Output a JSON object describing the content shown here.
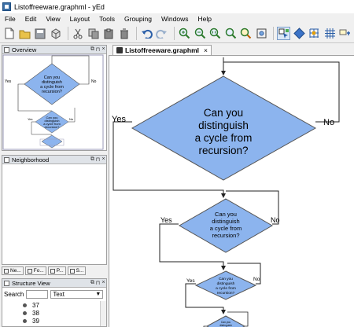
{
  "window": {
    "title": "Listoffreeware.graphml - yEd"
  },
  "menu": [
    "File",
    "Edit",
    "View",
    "Layout",
    "Tools",
    "Grouping",
    "Windows",
    "Help"
  ],
  "toolbar": {
    "icons": [
      "new-file-icon",
      "open-folder-icon",
      "save-icon",
      "3d-box-icon",
      "cut-icon",
      "copy-icon",
      "paste-icon",
      "delete-icon",
      "undo-icon",
      "redo-icon",
      "zoom-in-icon",
      "zoom-out-icon",
      "zoom-original-icon",
      "zoom-area-icon",
      "zoom-fit-icon",
      "fit-content-icon",
      "select-mode-icon",
      "navigate-icon",
      "grid-snap-icon",
      "grid-icon",
      "properties-icon"
    ]
  },
  "panels": {
    "overview": {
      "title": "Overview",
      "buttons": [
        "⧉",
        "⊓",
        "×"
      ]
    },
    "neighborhood": {
      "title": "Neighborhood",
      "buttons": [
        "⧉",
        "⊓",
        "×"
      ]
    },
    "bottom_tabs": [
      "Ne...",
      "Fo...",
      "P...",
      "S..."
    ],
    "structure": {
      "title": "Structure View",
      "buttons": [
        "⧉",
        "⊓",
        "×"
      ],
      "search_label": "Search",
      "search_value": "",
      "filter_value": "Text",
      "tree_items": [
        "37",
        "38",
        "39"
      ]
    }
  },
  "document_tab": {
    "title": "Listoffreeware.graphml",
    "close": "×"
  },
  "graph": {
    "question_line1": "Can you",
    "question_line2": "distinguish",
    "question_line3": "a cycle from",
    "question_line4": "recursion?",
    "yes_label": "Yes",
    "no_label": "No",
    "node_fill": "#8cb4ee",
    "node_stroke": "#555555"
  }
}
